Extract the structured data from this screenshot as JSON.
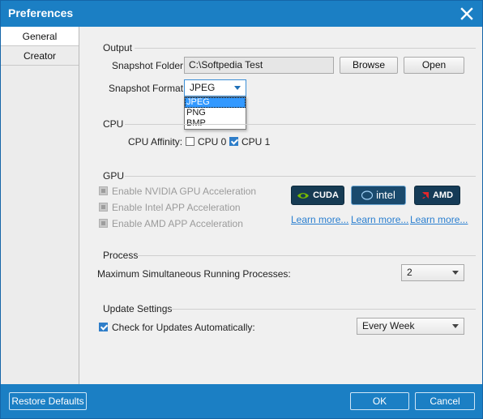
{
  "window": {
    "title": "Preferences"
  },
  "sidebar": {
    "items": [
      {
        "label": "General"
      },
      {
        "label": "Creator"
      }
    ]
  },
  "output": {
    "section_title": "Output",
    "snapshot_folder_label": "Snapshot Folder:",
    "snapshot_folder_value": "C:\\Softpedia Test",
    "browse_label": "Browse",
    "open_label": "Open",
    "snapshot_format_label": "Snapshot Format:",
    "snapshot_format_value": "JPEG",
    "format_options": [
      "JPEG",
      "PNG",
      "BMP"
    ]
  },
  "cpu": {
    "section_title": "CPU",
    "affinity_label": "CPU Affinity:",
    "cpu0_label": "CPU 0",
    "cpu0_checked": false,
    "cpu1_label": "CPU 1",
    "cpu1_checked": true
  },
  "gpu": {
    "section_title": "GPU",
    "nvidia_label": "Enable NVIDIA GPU Acceleration",
    "intel_label": "Enable Intel APP Acceleration",
    "amd_label": "Enable AMD APP Acceleration",
    "cuda_badge": "CUDA",
    "intel_badge": "intel",
    "amd_badge": "AMD",
    "learn_more_1": "Learn more...",
    "learn_more_2": "Learn more...",
    "learn_more_3": "Learn more..."
  },
  "process": {
    "section_title": "Process",
    "max_label": "Maximum Simultaneous Running Processes:",
    "max_value": "2"
  },
  "update": {
    "section_title": "Update Settings",
    "check_label": "Check for Updates Automatically:",
    "check_checked": true,
    "frequency_value": "Every Week"
  },
  "footer": {
    "restore_label": "Restore Defaults",
    "ok_label": "OK",
    "cancel_label": "Cancel"
  },
  "colors": {
    "accent": "#1b7fc4",
    "link": "#2a7fd0"
  }
}
